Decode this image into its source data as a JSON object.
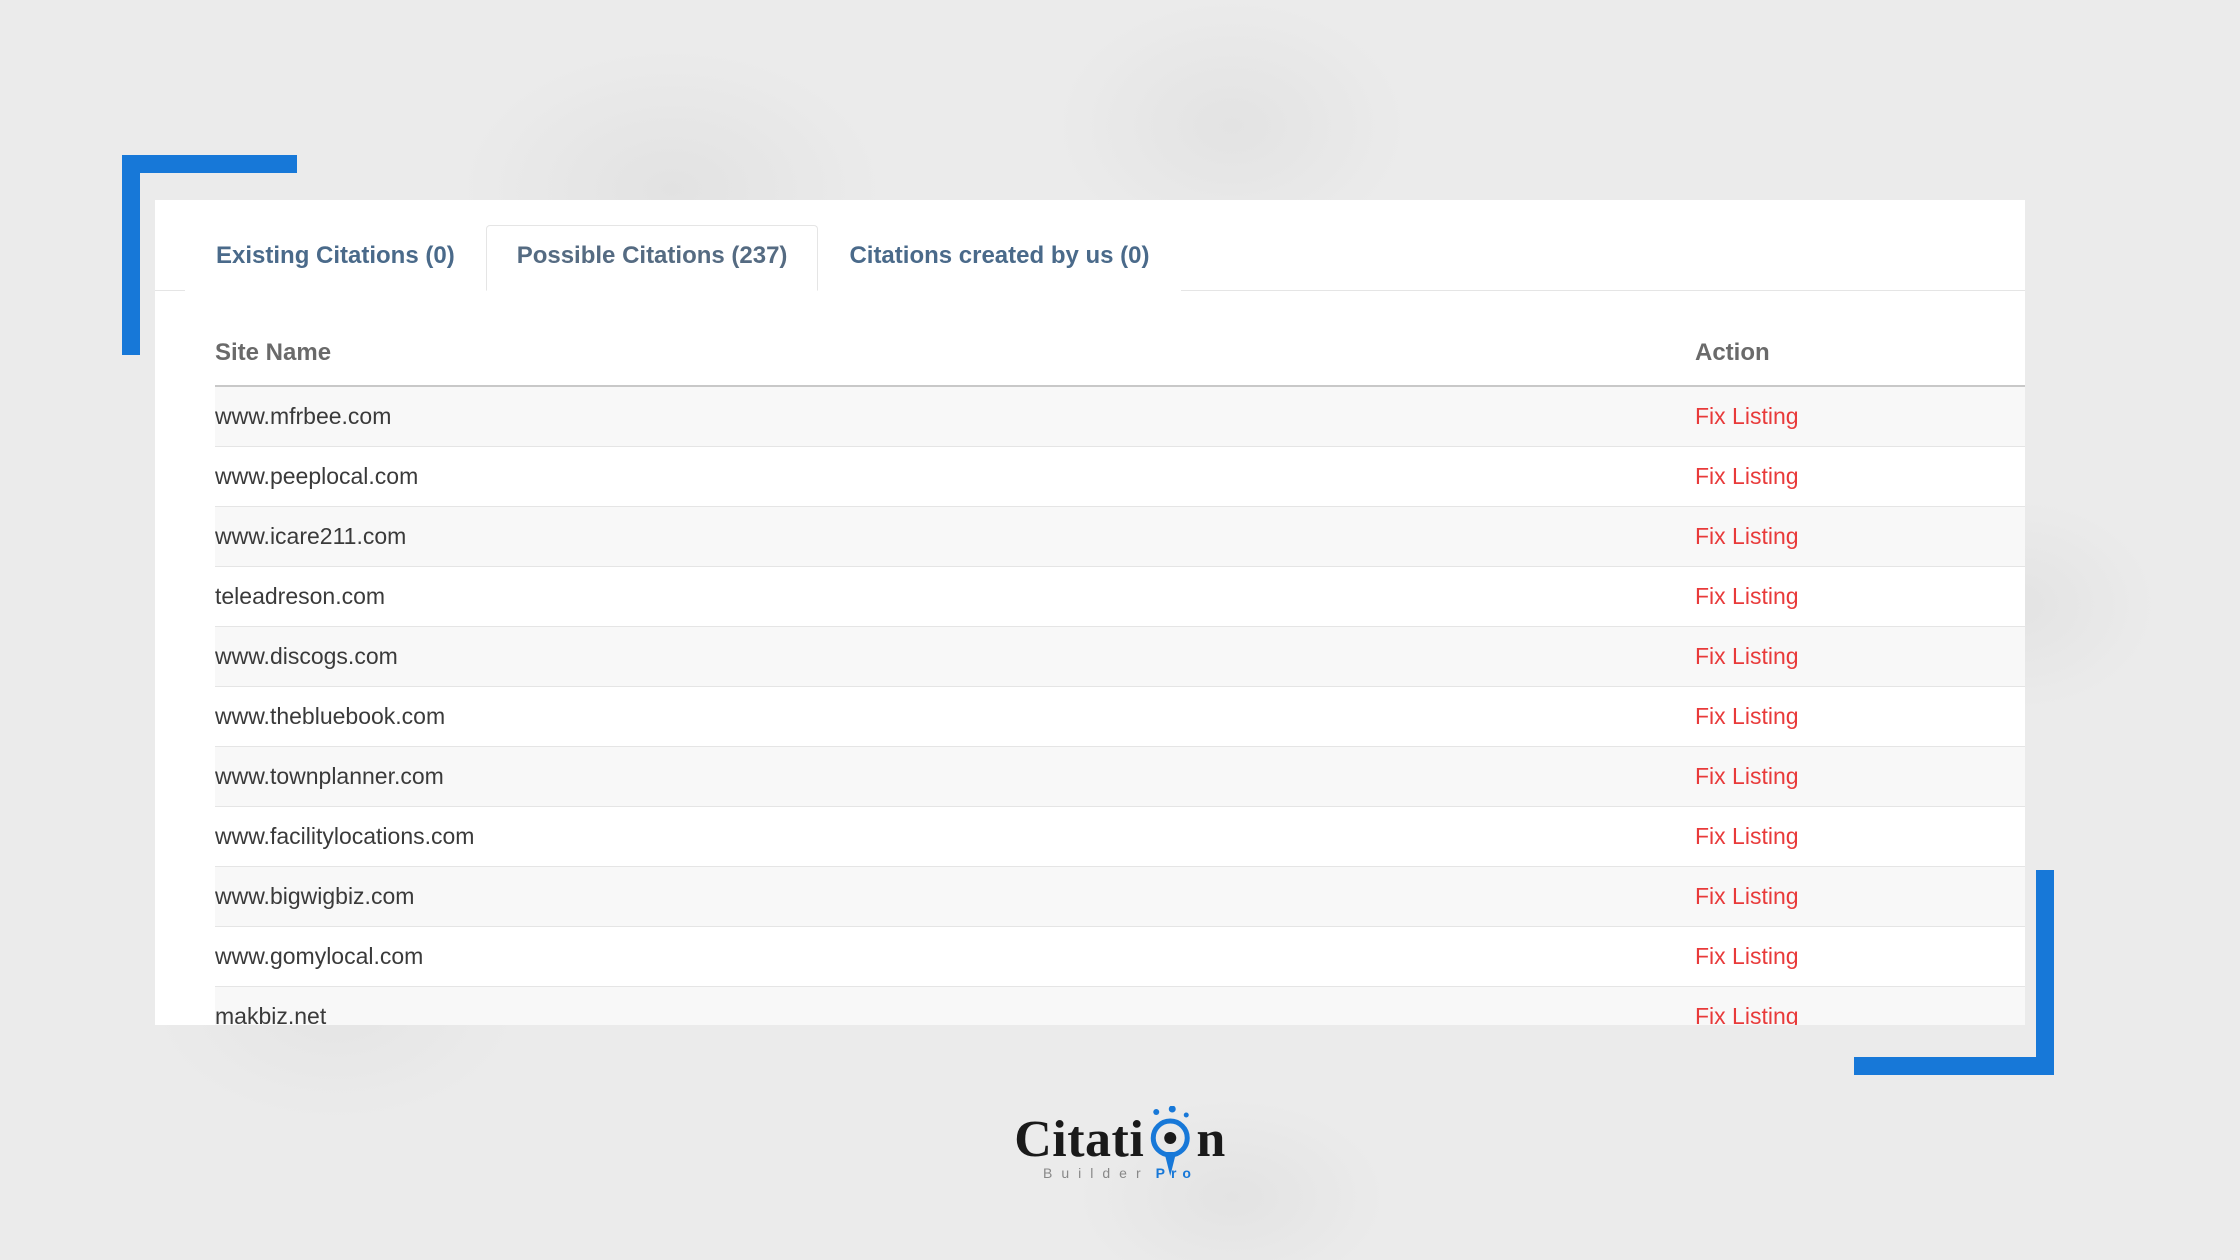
{
  "tabs": {
    "existing": {
      "label": "Existing Citations (0)"
    },
    "possible": {
      "label": "Possible Citations (237)"
    },
    "created": {
      "label": "Citations created by us (0)"
    }
  },
  "table": {
    "headers": {
      "site": "Site Name",
      "action": "Action"
    },
    "action_label": "Fix Listing",
    "rows": [
      {
        "site": "www.mfrbee.com"
      },
      {
        "site": "www.peeplocal.com"
      },
      {
        "site": "www.icare211.com"
      },
      {
        "site": "teleadreson.com"
      },
      {
        "site": "www.discogs.com"
      },
      {
        "site": "www.thebluebook.com"
      },
      {
        "site": "www.townplanner.com"
      },
      {
        "site": "www.facilitylocations.com"
      },
      {
        "site": "www.bigwigbiz.com"
      },
      {
        "site": "www.gomylocal.com"
      },
      {
        "site": "makbiz.net"
      }
    ]
  },
  "logo": {
    "part1": "Citati",
    "part2": "n",
    "sub1": "Builder",
    "sub2": "Pro"
  },
  "colors": {
    "accent": "#1778d8",
    "action": "#e83a3a"
  }
}
